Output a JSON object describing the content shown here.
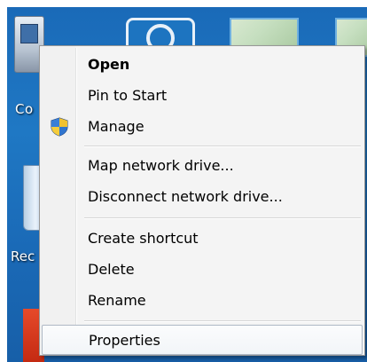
{
  "desktop": {
    "icons": {
      "computer_label": "Co",
      "recycle_label": "Rec"
    }
  },
  "context_menu": {
    "default_item": "Open",
    "groups": [
      {
        "items": [
          {
            "label": "Open",
            "icon": null,
            "default": true
          },
          {
            "label": "Pin to Start",
            "icon": null
          },
          {
            "label": "Manage",
            "icon": "uac-shield-icon"
          }
        ]
      },
      {
        "items": [
          {
            "label": "Map network drive..."
          },
          {
            "label": "Disconnect network drive..."
          }
        ]
      },
      {
        "items": [
          {
            "label": "Create shortcut"
          },
          {
            "label": "Delete"
          },
          {
            "label": "Rename"
          }
        ]
      },
      {
        "items": [
          {
            "label": "Properties",
            "hovered": true
          }
        ]
      }
    ]
  },
  "colors": {
    "menu_background": "#f4f4f4",
    "menu_border": "#979797",
    "hover_border": "#aeb8c4",
    "desktop_background": "#1a6ab8"
  }
}
